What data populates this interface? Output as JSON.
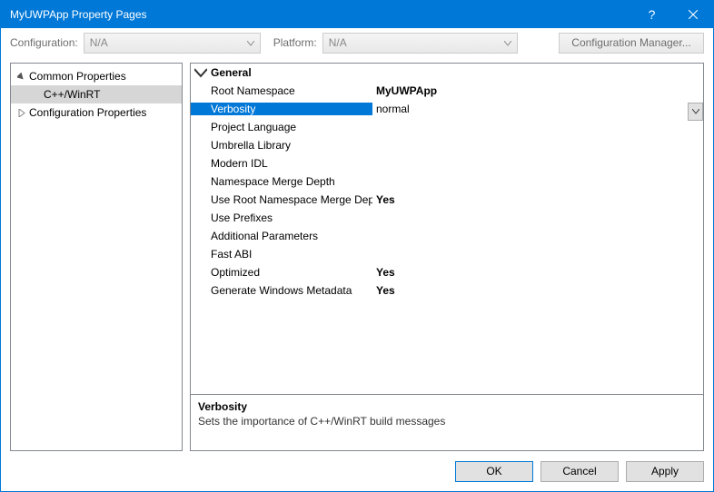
{
  "window": {
    "title": "MyUWPApp Property Pages"
  },
  "toolbar": {
    "configuration_label": "Configuration:",
    "configuration_value": "N/A",
    "platform_label": "Platform:",
    "platform_value": "N/A",
    "config_manager_label": "Configuration Manager..."
  },
  "tree": {
    "common_properties": "Common Properties",
    "cpp_winrt": "C++/WinRT",
    "configuration_properties": "Configuration Properties"
  },
  "grid": {
    "category": "General",
    "rows": {
      "root_namespace": {
        "name": "Root Namespace",
        "value": "MyUWPApp"
      },
      "verbosity": {
        "name": "Verbosity",
        "value": "normal"
      },
      "project_language": {
        "name": "Project Language",
        "value": ""
      },
      "umbrella_library": {
        "name": "Umbrella Library",
        "value": ""
      },
      "modern_idl": {
        "name": "Modern IDL",
        "value": ""
      },
      "namespace_merge_depth": {
        "name": "Namespace Merge Depth",
        "value": ""
      },
      "use_root_ns_merge_depth": {
        "name": "Use Root Namespace Merge Dept",
        "value": "Yes"
      },
      "use_prefixes": {
        "name": "Use Prefixes",
        "value": ""
      },
      "additional_parameters": {
        "name": "Additional Parameters",
        "value": ""
      },
      "fast_abi": {
        "name": "Fast ABI",
        "value": ""
      },
      "optimized": {
        "name": "Optimized",
        "value": "Yes"
      },
      "generate_windows_metadata": {
        "name": "Generate Windows Metadata",
        "value": "Yes"
      }
    }
  },
  "description": {
    "title": "Verbosity",
    "text": "Sets the importance of C++/WinRT build messages"
  },
  "buttons": {
    "ok": "OK",
    "cancel": "Cancel",
    "apply": "Apply"
  }
}
